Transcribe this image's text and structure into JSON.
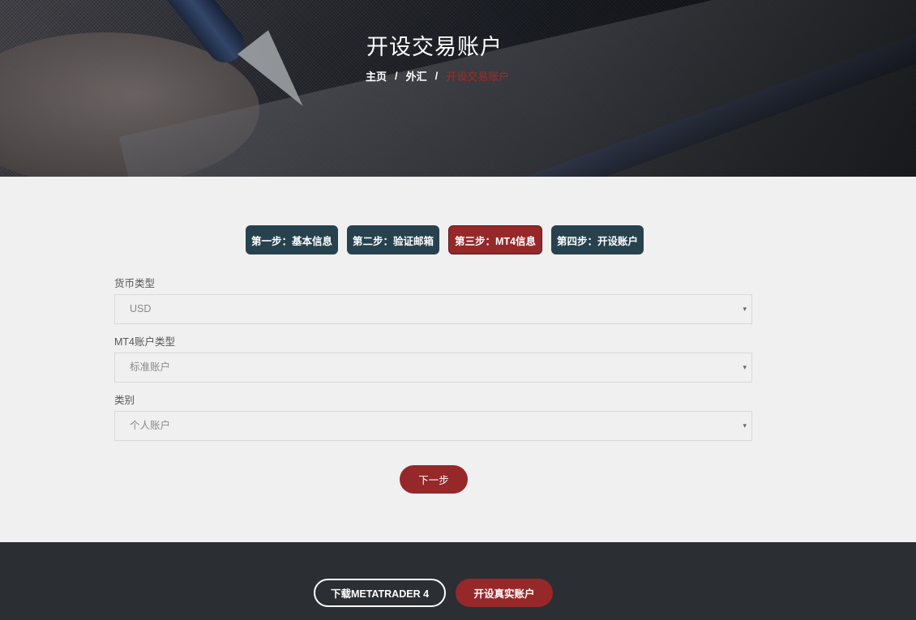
{
  "hero": {
    "title": "开设交易账户",
    "breadcrumb": {
      "home": "主页",
      "sep1": "/",
      "forex": "外汇",
      "sep2": "/",
      "current": "开设交易账户"
    }
  },
  "steps": [
    {
      "label": "第一步：基本信息",
      "active": false
    },
    {
      "label": "第二步：验证邮箱",
      "active": false
    },
    {
      "label": "第三步：MT4信息",
      "active": true
    },
    {
      "label": "第四步：开设账户",
      "active": false
    }
  ],
  "form": {
    "currency": {
      "label": "货币类型",
      "value": "USD"
    },
    "account_type": {
      "label": "MT4账户类型",
      "value": "标准账户"
    },
    "category": {
      "label": "类别",
      "value": "个人账户"
    },
    "dropdown_icon": "▾"
  },
  "next_button": "下一步",
  "footer": {
    "download_label": "下载METATRADER 4",
    "open_real_label": "开设真实账户"
  },
  "colors": {
    "accent": "#96282a",
    "step_bg": "#27424e",
    "footer_bg": "#2b2e33",
    "page_bg": "#f0f0f0"
  }
}
